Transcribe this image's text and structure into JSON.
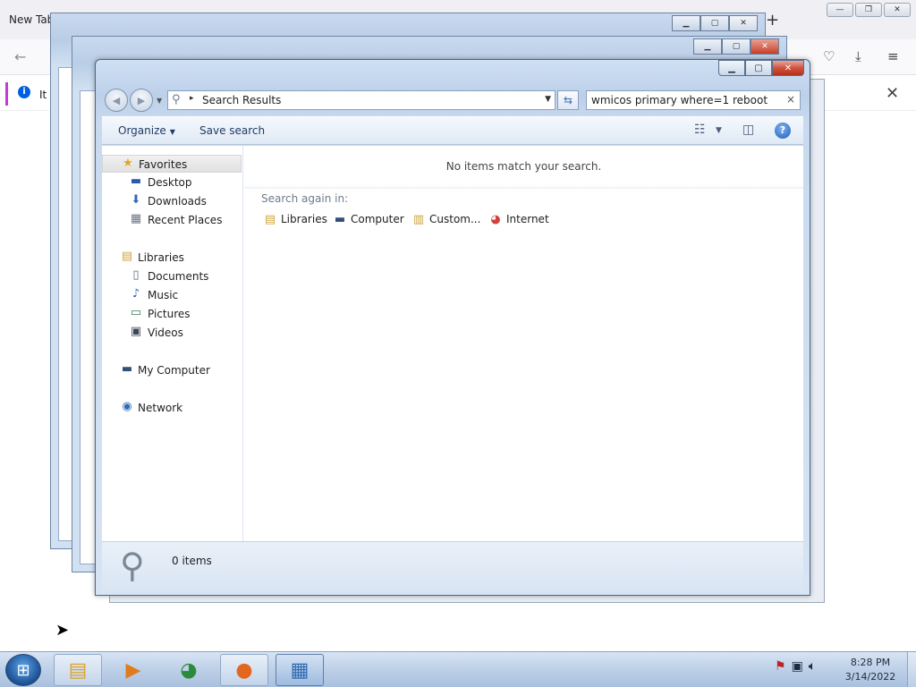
{
  "firefox": {
    "tab_title": "New Tab",
    "new_tab_symbol": "+",
    "notice_text": "It l",
    "notice_close": "✕",
    "window_controls": [
      "—",
      "❐",
      "✕"
    ]
  },
  "explorer": {
    "window_controls": {
      "minimize": "▁",
      "maximize": "▢",
      "close": "✕"
    },
    "address": {
      "breadcrumb_arrow": "▸",
      "text": "Search Results"
    },
    "search": {
      "value": "wmicos primary where=1 reboot",
      "clear": "×"
    },
    "toolbar": {
      "organize": "Organize",
      "save_search": "Save search",
      "help": "?"
    },
    "nav_pane": {
      "favorites": {
        "label": "Favorites",
        "icon": "star-icon"
      },
      "favorites_items": [
        {
          "label": "Desktop",
          "icon": "desktop-icon"
        },
        {
          "label": "Downloads",
          "icon": "downloads-icon"
        },
        {
          "label": "Recent Places",
          "icon": "recent-places-icon"
        }
      ],
      "libraries": {
        "label": "Libraries",
        "icon": "libraries-icon"
      },
      "libraries_items": [
        {
          "label": "Documents",
          "icon": "documents-icon"
        },
        {
          "label": "Music",
          "icon": "music-icon"
        },
        {
          "label": "Pictures",
          "icon": "pictures-icon"
        },
        {
          "label": "Videos",
          "icon": "videos-icon"
        }
      ],
      "computer": {
        "label": "My Computer",
        "icon": "computer-icon"
      },
      "network": {
        "label": "Network",
        "icon": "network-icon"
      }
    },
    "results": {
      "empty_message": "No items match your search.",
      "search_again_label": "Search again in:",
      "search_again_links": [
        {
          "label": "Libraries",
          "icon": "libraries-icon"
        },
        {
          "label": "Computer",
          "icon": "computer-icon"
        },
        {
          "label": "Custom...",
          "icon": "custom-folder-icon"
        },
        {
          "label": "Internet",
          "icon": "chrome-icon"
        }
      ]
    },
    "details": {
      "count": "0 items"
    }
  },
  "taskbar": {
    "clock_time": "8:28 PM",
    "clock_date": "3/14/2022",
    "pinned": [
      {
        "name": "windows-explorer",
        "icon": "folder-icon",
        "state": "open"
      },
      {
        "name": "media-player",
        "icon": "media-player-icon",
        "state": "pinned"
      },
      {
        "name": "chrome",
        "icon": "chrome-icon",
        "state": "pinned"
      },
      {
        "name": "firefox",
        "icon": "firefox-icon",
        "state": "open"
      },
      {
        "name": "control-panel",
        "icon": "control-panel-icon",
        "state": "active"
      }
    ],
    "tray_icons": [
      "action-center-icon",
      "network-tray-icon",
      "volume-icon"
    ]
  }
}
